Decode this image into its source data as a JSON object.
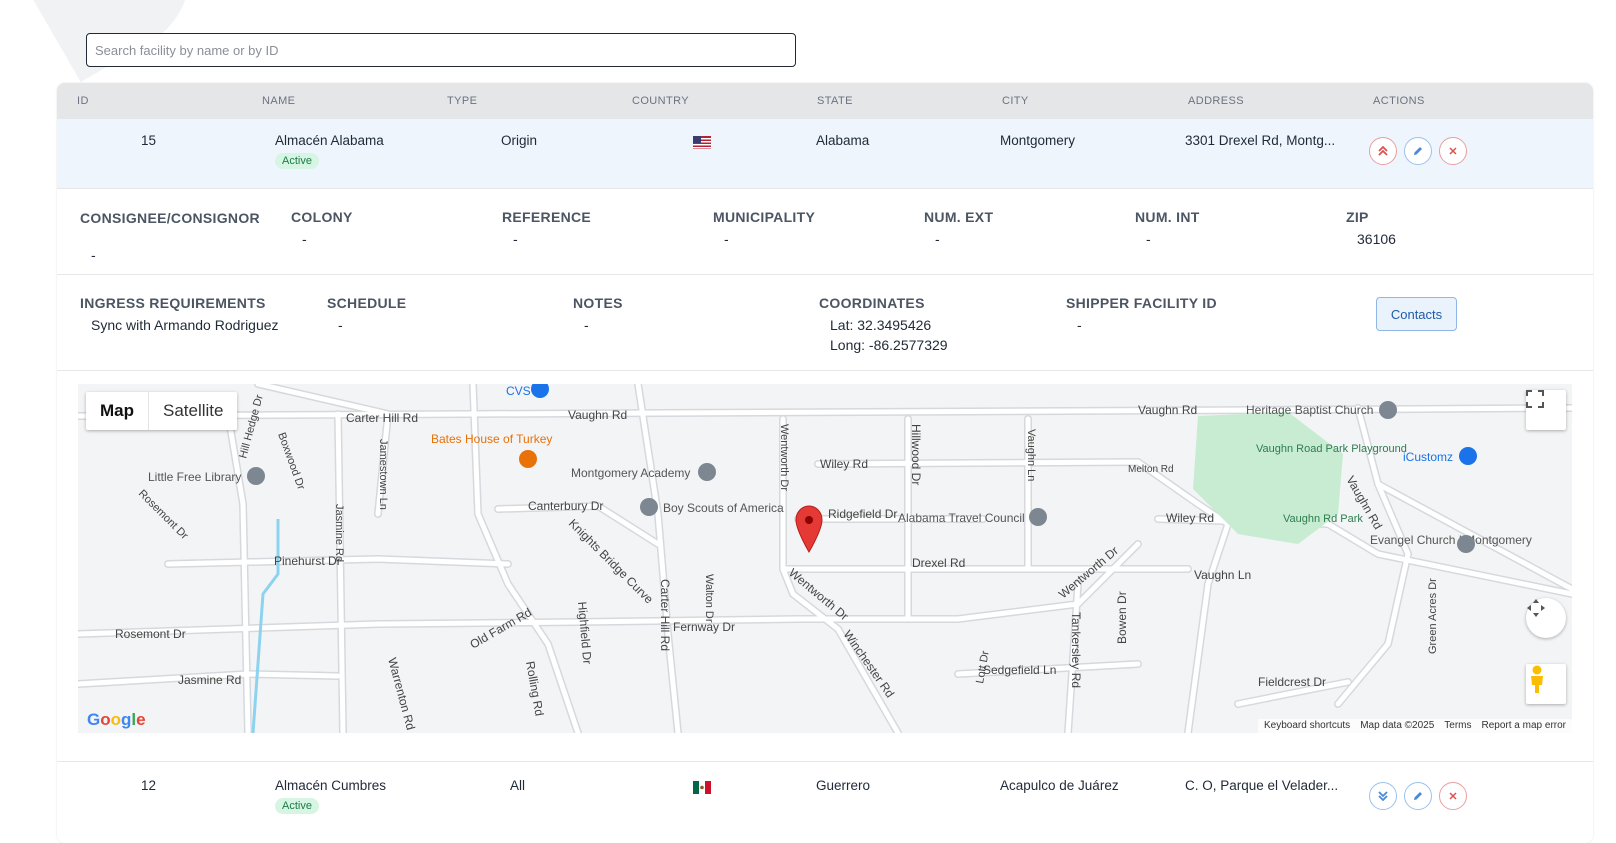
{
  "search": {
    "placeholder": "Search facility by name or by ID"
  },
  "columns": [
    "ID",
    "NAME",
    "TYPE",
    "COUNTRY",
    "STATE",
    "CITY",
    "ADDRESS",
    "ACTIONS"
  ],
  "rows": [
    {
      "id": "15",
      "name": "Almacén Alabama",
      "status": "Active",
      "type": "Origin",
      "country_flag": "us-flag",
      "state": "Alabama",
      "city": "Montgomery",
      "address": "3301 Drexel Rd, Montg..."
    },
    {
      "id": "12",
      "name": "Almacén Cumbres",
      "status": "Active",
      "type": "All",
      "country_flag": "mx-flag",
      "state": "Guerrero",
      "city": "Acapulco de Juárez",
      "address": "C. O, Parque el Velader..."
    }
  ],
  "details": {
    "consignee_label": "CONSIGNEE/CONSIGNOR",
    "consignee_value": "-",
    "colony_label": "COLONY",
    "colony_value": "-",
    "reference_label": "REFERENCE",
    "reference_value": "-",
    "municipality_label": "MUNICIPALITY",
    "municipality_value": "-",
    "num_ext_label": "NUM. EXT",
    "num_ext_value": "-",
    "num_int_label": "NUM. INT",
    "num_int_value": "-",
    "zip_label": "ZIP",
    "zip_value": "36106",
    "ingress_label": "INGRESS REQUIREMENTS",
    "ingress_value": "Sync with Armando Rodriguez",
    "schedule_label": "SCHEDULE",
    "schedule_value": "-",
    "notes_label": "NOTES",
    "notes_value": "-",
    "coordinates_label": "COORDINATES",
    "lat": "Lat: 32.3495426",
    "long": "Long: -86.2577329",
    "shipper_label": "SHIPPER FACILITY ID",
    "shipper_value": "-",
    "contacts_button": "Contacts"
  },
  "map": {
    "map_tab": "Map",
    "satellite_tab": "Satellite",
    "footer": [
      "Keyboard shortcuts",
      "Map data ©2025",
      "Terms",
      "Report a map error"
    ],
    "logo": "Google",
    "labels": {
      "vaughn_rd": "Vaughn Rd",
      "carter_hill_rd": "Carter Hill Rd",
      "cvs": "CVS",
      "heritage": "Heritage Baptist Church",
      "bates": "Bates House of Turkey",
      "academy": "Montgomery Academy",
      "wiley_rd": "Wiley Rd",
      "melton_rd": "Melton Rd",
      "icustomz": "iCustomz",
      "little_free": "Little Free Library",
      "canterbury": "Canterbury Dr",
      "boy_scouts": "Boy Scouts of America",
      "ridgefield": "Ridgefield Dr",
      "travel_council": "Alabama Travel Council",
      "vaughn_park": "Vaughn Rd Park",
      "playground": "Vaughn Road Park Playground",
      "evangel": "Evangel Church | Montgomery",
      "pinehurst": "Pinehurst Dr",
      "knights": "Knights Bridge Curve",
      "drexel": "Drexel Rd",
      "wentworth": "Wentworth Dr",
      "vaughn_ln": "Vaughn Ln",
      "rosemont": "Rosemont Dr",
      "fernway": "Fernway Dr",
      "jasmine": "Jasmine Rd",
      "sedgefield": "Sedgefield Ln",
      "fieldcrest": "Fieldcrest Dr",
      "old_farm": "Old Farm Rd",
      "tankersley": "Tankersley Rd",
      "bowen": "Bowen Dr",
      "winchester": "Winchester Rd",
      "highfield": "Highfield Dr",
      "rolling": "Rolling Rd",
      "warrenton": "Warrenton Rd",
      "hillwood": "Hillwood Dr",
      "jamestown": "Jamestown Ln",
      "boxwood": "Boxwood Dr",
      "hill_hedge": "Hill Hedge Dr",
      "walton": "Walton Dr",
      "lott": "Lott Dr",
      "green_acres": "Green Acres Dr"
    },
    "colors": {
      "park": "#c7ecd2",
      "road": "#ffffff",
      "road_edge": "#d5d9de",
      "water": "#8dd3ef",
      "pin": "#e53935"
    }
  }
}
